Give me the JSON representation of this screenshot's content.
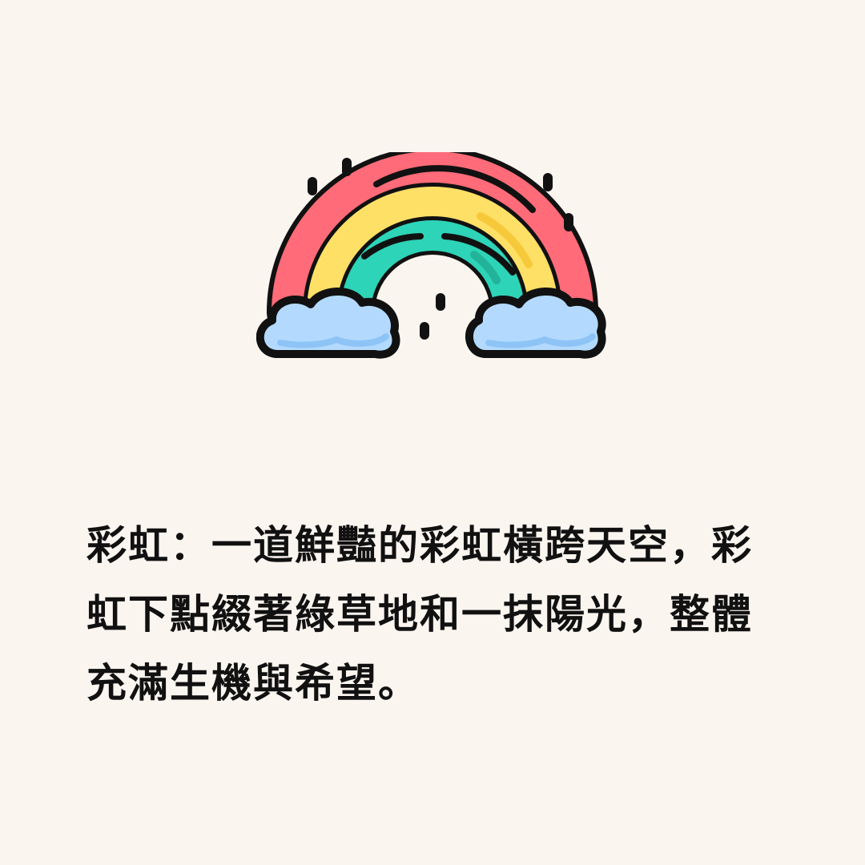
{
  "background_color": "#fbf5f0",
  "illustration": {
    "icon": "rainbow-with-clouds-icon",
    "colors": {
      "red": "#ff6b78",
      "yellow": "#ffe066",
      "green": "#2dd4b7",
      "cloud": "#b3dafe",
      "outline": "#111111"
    }
  },
  "caption": {
    "text": "彩虹：一道鮮豔的彩虹橫跨天空，彩虹下點綴著綠草地和一抹陽光，整體充滿生機與希望。"
  }
}
